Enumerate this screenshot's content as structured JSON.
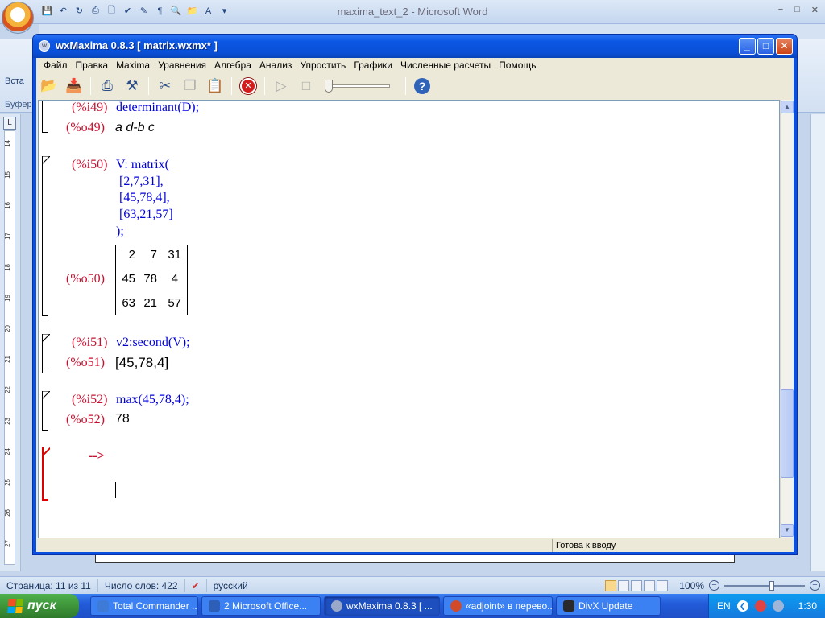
{
  "word": {
    "title": "maxima_text_2 - Microsoft Word",
    "paste_label": "Вста",
    "clipboard_label": "Буфер",
    "ruler_numbers": [
      "14",
      "15",
      "16",
      "17",
      "18",
      "19",
      "20",
      "21",
      "22",
      "23",
      "24",
      "25",
      "26",
      "27"
    ],
    "status": {
      "page": "Страница: 11 из 11",
      "words": "Число слов: 422",
      "language": "русский",
      "zoom": "100%"
    }
  },
  "taskbar": {
    "start": "пуск",
    "tasks": [
      {
        "label": "Total Commander ...",
        "color": "#3d7bd6"
      },
      {
        "label": "2 Microsoft Office...",
        "color": "#2e5fb8"
      },
      {
        "label": "wxMaxima 0.8.3 [ ...",
        "color": "#9aa9c9"
      },
      {
        "label": "«adjoint» в перево...",
        "color": "#d14b2a"
      },
      {
        "label": "DivX Update",
        "color": "#2a2a2a"
      }
    ],
    "tray": {
      "lang": "EN",
      "time": "1:30"
    }
  },
  "wx": {
    "title": "wxMaxima 0.8.3 [ matrix.wxmx* ]",
    "menu": [
      "Файл",
      "Правка",
      "Maxima",
      "Уравнения",
      "Алгебра",
      "Анализ",
      "Упростить",
      "Графики",
      "Численные расчеты",
      "Помощь"
    ],
    "status": "Готова к вводу",
    "cells": {
      "i49": {
        "label": "(%i49)",
        "input": "determinant(D);"
      },
      "o49": {
        "label": "(%o49)",
        "output": "a d-b c"
      },
      "i50": {
        "label": "(%i50)",
        "lines": [
          "V: matrix(",
          " [2,7,31],",
          " [45,78,4],",
          " [63,21,57]",
          ");"
        ]
      },
      "o50": {
        "label": "(%o50)",
        "matrix": [
          [
            "2",
            "7",
            "31"
          ],
          [
            "45",
            "78",
            "4"
          ],
          [
            "63",
            "21",
            "57"
          ]
        ]
      },
      "i51": {
        "label": "(%i51)",
        "input": "v2:second(V);"
      },
      "o51": {
        "label": "(%o51)",
        "output": "[45,78,4]"
      },
      "i52": {
        "label": "(%i52)",
        "input": "max(45,78,4);"
      },
      "o52": {
        "label": "(%o52)",
        "output": "78"
      },
      "prompt": "-->"
    }
  }
}
